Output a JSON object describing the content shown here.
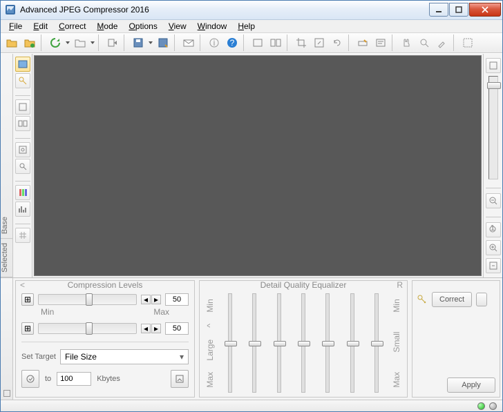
{
  "window": {
    "title": "Advanced JPEG Compressor 2016"
  },
  "menu": {
    "file": "File",
    "edit": "Edit",
    "correct": "Correct",
    "mode": "Mode",
    "options": "Options",
    "view": "View",
    "window": "Window",
    "help": "Help"
  },
  "side_tabs": {
    "selected": "Selected",
    "base": "Base"
  },
  "compression": {
    "title": "Compression Levels",
    "arrow_left": "<",
    "slider1_value": "50",
    "slider2_value": "50",
    "min_label": "Min",
    "max_label": "Max",
    "set_target_label": "Set Target",
    "set_target_combo": "File Size",
    "to_label": "to",
    "target_value": "100",
    "unit_label": "Kbytes"
  },
  "equalizer": {
    "title": "Detail Quality Equalizer",
    "right_char": "R",
    "caret": "^",
    "max_label": "Max",
    "min_label": "Min",
    "large_label": "Large",
    "small_label": "Small",
    "bands": [
      50,
      50,
      50,
      50,
      50,
      50,
      50
    ]
  },
  "correct_panel": {
    "correct_btn": "Correct",
    "apply_btn": "Apply"
  }
}
